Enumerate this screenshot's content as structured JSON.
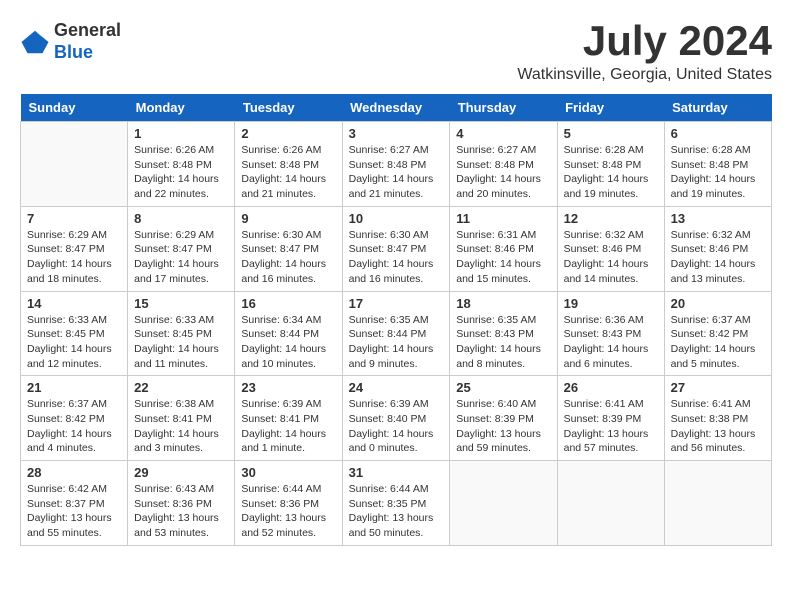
{
  "logo": {
    "general": "General",
    "blue": "Blue"
  },
  "title": "July 2024",
  "location": "Watkinsville, Georgia, United States",
  "days_of_week": [
    "Sunday",
    "Monday",
    "Tuesday",
    "Wednesday",
    "Thursday",
    "Friday",
    "Saturday"
  ],
  "weeks": [
    [
      {
        "day": "",
        "detail": ""
      },
      {
        "day": "1",
        "detail": "Sunrise: 6:26 AM\nSunset: 8:48 PM\nDaylight: 14 hours and 22 minutes."
      },
      {
        "day": "2",
        "detail": "Sunrise: 6:26 AM\nSunset: 8:48 PM\nDaylight: 14 hours and 21 minutes."
      },
      {
        "day": "3",
        "detail": "Sunrise: 6:27 AM\nSunset: 8:48 PM\nDaylight: 14 hours and 21 minutes."
      },
      {
        "day": "4",
        "detail": "Sunrise: 6:27 AM\nSunset: 8:48 PM\nDaylight: 14 hours and 20 minutes."
      },
      {
        "day": "5",
        "detail": "Sunrise: 6:28 AM\nSunset: 8:48 PM\nDaylight: 14 hours and 19 minutes."
      },
      {
        "day": "6",
        "detail": "Sunrise: 6:28 AM\nSunset: 8:48 PM\nDaylight: 14 hours and 19 minutes."
      }
    ],
    [
      {
        "day": "7",
        "detail": "Sunrise: 6:29 AM\nSunset: 8:47 PM\nDaylight: 14 hours and 18 minutes."
      },
      {
        "day": "8",
        "detail": "Sunrise: 6:29 AM\nSunset: 8:47 PM\nDaylight: 14 hours and 17 minutes."
      },
      {
        "day": "9",
        "detail": "Sunrise: 6:30 AM\nSunset: 8:47 PM\nDaylight: 14 hours and 16 minutes."
      },
      {
        "day": "10",
        "detail": "Sunrise: 6:30 AM\nSunset: 8:47 PM\nDaylight: 14 hours and 16 minutes."
      },
      {
        "day": "11",
        "detail": "Sunrise: 6:31 AM\nSunset: 8:46 PM\nDaylight: 14 hours and 15 minutes."
      },
      {
        "day": "12",
        "detail": "Sunrise: 6:32 AM\nSunset: 8:46 PM\nDaylight: 14 hours and 14 minutes."
      },
      {
        "day": "13",
        "detail": "Sunrise: 6:32 AM\nSunset: 8:46 PM\nDaylight: 14 hours and 13 minutes."
      }
    ],
    [
      {
        "day": "14",
        "detail": "Sunrise: 6:33 AM\nSunset: 8:45 PM\nDaylight: 14 hours and 12 minutes."
      },
      {
        "day": "15",
        "detail": "Sunrise: 6:33 AM\nSunset: 8:45 PM\nDaylight: 14 hours and 11 minutes."
      },
      {
        "day": "16",
        "detail": "Sunrise: 6:34 AM\nSunset: 8:44 PM\nDaylight: 14 hours and 10 minutes."
      },
      {
        "day": "17",
        "detail": "Sunrise: 6:35 AM\nSunset: 8:44 PM\nDaylight: 14 hours and 9 minutes."
      },
      {
        "day": "18",
        "detail": "Sunrise: 6:35 AM\nSunset: 8:43 PM\nDaylight: 14 hours and 8 minutes."
      },
      {
        "day": "19",
        "detail": "Sunrise: 6:36 AM\nSunset: 8:43 PM\nDaylight: 14 hours and 6 minutes."
      },
      {
        "day": "20",
        "detail": "Sunrise: 6:37 AM\nSunset: 8:42 PM\nDaylight: 14 hours and 5 minutes."
      }
    ],
    [
      {
        "day": "21",
        "detail": "Sunrise: 6:37 AM\nSunset: 8:42 PM\nDaylight: 14 hours and 4 minutes."
      },
      {
        "day": "22",
        "detail": "Sunrise: 6:38 AM\nSunset: 8:41 PM\nDaylight: 14 hours and 3 minutes."
      },
      {
        "day": "23",
        "detail": "Sunrise: 6:39 AM\nSunset: 8:41 PM\nDaylight: 14 hours and 1 minute."
      },
      {
        "day": "24",
        "detail": "Sunrise: 6:39 AM\nSunset: 8:40 PM\nDaylight: 14 hours and 0 minutes."
      },
      {
        "day": "25",
        "detail": "Sunrise: 6:40 AM\nSunset: 8:39 PM\nDaylight: 13 hours and 59 minutes."
      },
      {
        "day": "26",
        "detail": "Sunrise: 6:41 AM\nSunset: 8:39 PM\nDaylight: 13 hours and 57 minutes."
      },
      {
        "day": "27",
        "detail": "Sunrise: 6:41 AM\nSunset: 8:38 PM\nDaylight: 13 hours and 56 minutes."
      }
    ],
    [
      {
        "day": "28",
        "detail": "Sunrise: 6:42 AM\nSunset: 8:37 PM\nDaylight: 13 hours and 55 minutes."
      },
      {
        "day": "29",
        "detail": "Sunrise: 6:43 AM\nSunset: 8:36 PM\nDaylight: 13 hours and 53 minutes."
      },
      {
        "day": "30",
        "detail": "Sunrise: 6:44 AM\nSunset: 8:36 PM\nDaylight: 13 hours and 52 minutes."
      },
      {
        "day": "31",
        "detail": "Sunrise: 6:44 AM\nSunset: 8:35 PM\nDaylight: 13 hours and 50 minutes."
      },
      {
        "day": "",
        "detail": ""
      },
      {
        "day": "",
        "detail": ""
      },
      {
        "day": "",
        "detail": ""
      }
    ]
  ]
}
